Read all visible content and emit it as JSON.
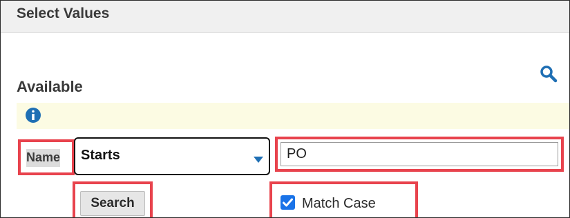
{
  "dialog": {
    "title": "Select Values"
  },
  "available": {
    "heading": "Available"
  },
  "filter": {
    "field_label": "Name",
    "operator_value": "Starts",
    "search_value": "PO",
    "search_button_label": "Search",
    "match_case_label": "Match Case",
    "match_case_checked": true
  },
  "icons": {
    "search": "magnifier-icon",
    "info": "info-icon",
    "dropdown": "caret-down-icon",
    "checkbox": "checkmark-icon"
  },
  "colors": {
    "highlight": "#e8434d",
    "accent": "#1f6fb4",
    "info_bar": "#fcfbe3",
    "checkbox": "#1a73e8"
  }
}
